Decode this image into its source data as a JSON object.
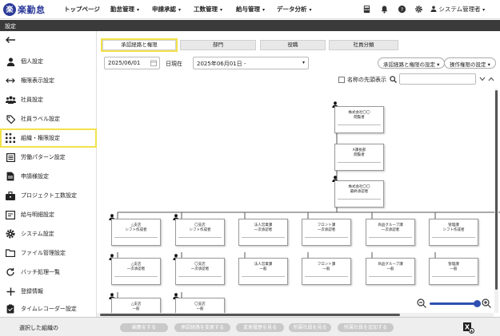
{
  "app": {
    "logo_mark": "楽",
    "logo_text": "楽勤怠"
  },
  "nav": [
    {
      "label": "トップページ",
      "caret": ""
    },
    {
      "label": "勤怠管理",
      "caret": "▾"
    },
    {
      "label": "申請承認",
      "caret": "▾"
    },
    {
      "label": "工数管理",
      "caret": "▾"
    },
    {
      "label": "給与管理",
      "caret": "▾"
    },
    {
      "label": "データ分析",
      "caret": "▾"
    }
  ],
  "user": {
    "name": "システム管理者",
    "caret": "▾"
  },
  "settings_title": "設定",
  "sidebar": {
    "items": [
      {
        "label": "個人設定",
        "icon": "person-icon"
      },
      {
        "label": "権限表示設定",
        "icon": "arrows-icon"
      },
      {
        "label": "社員設定",
        "icon": "group-icon"
      },
      {
        "label": "社員ラベル設定",
        "icon": "tag-icon"
      },
      {
        "label": "組織・権限設定",
        "icon": "grid-icon"
      },
      {
        "label": "労働パターン設定",
        "icon": "list-icon"
      },
      {
        "label": "申請様設定",
        "icon": "doc-icon"
      },
      {
        "label": "プロジェクト工数設定",
        "icon": "briefcase-icon"
      },
      {
        "label": "給与明細設定",
        "icon": "yen-icon"
      },
      {
        "label": "システム設定",
        "icon": "gear-icon"
      },
      {
        "label": "ファイル管理設定",
        "icon": "folder-icon"
      },
      {
        "label": "バッチ処理一覧",
        "icon": "refresh-icon"
      },
      {
        "label": "登録情報",
        "icon": "plus-icon"
      },
      {
        "label": "タイムレコーダー設定",
        "icon": "clipboard-icon"
      }
    ]
  },
  "tabs": [
    "承認経路と権限",
    "部門",
    "役職",
    "社員分類"
  ],
  "date": {
    "value": "2025/06/01",
    "label": "日現在",
    "selected": "2025年06月01日 -"
  },
  "actions": {
    "route_setting": "承認経路と権限の設定",
    "op_setting": "操作権限の設定"
  },
  "options": {
    "checkbox_label": "名称の先頭表示"
  },
  "org": {
    "top": [
      {
        "line1": "株式会社〇〇",
        "line2": "閲覧者"
      },
      {
        "line1": "A課長部",
        "line2": "閲覧者"
      },
      {
        "line1": "株式会社〇〇",
        "line2": "最終承認者"
      }
    ],
    "row1": [
      {
        "line1": "△支店",
        "line2": "シフト作成者"
      },
      {
        "line1": "〇支店",
        "line2": "シフト作成者"
      },
      {
        "line1": "法人営業課",
        "line2": "一次承認者"
      },
      {
        "line1": "フロント課",
        "line2": "一次承認者"
      },
      {
        "line1": "商品グループ課",
        "line2": "一次承認者"
      },
      {
        "line1": "管理課",
        "line2": "シフト作成者"
      }
    ],
    "row2": [
      {
        "line1": "△支店",
        "line2": "一次承認者"
      },
      {
        "line1": "〇支店",
        "line2": "一次承認者"
      },
      {
        "line1": "法人営業課",
        "line2": "一般"
      },
      {
        "line1": "フロント課",
        "line2": "一般"
      },
      {
        "line1": "商品グループ課",
        "line2": "一般"
      },
      {
        "line1": "管理課",
        "line2": "一般"
      }
    ],
    "row3": [
      {
        "line1": "△支店",
        "line2": "一般"
      },
      {
        "line1": "〇支店",
        "line2": "一般"
      }
    ]
  },
  "bottom": {
    "selected_label": "選択した組織の",
    "buttons": [
      "編集をする",
      "承認経路を変更する",
      "変更履歴を見る",
      "所属社員を見る",
      "所属社員を追加する"
    ]
  }
}
